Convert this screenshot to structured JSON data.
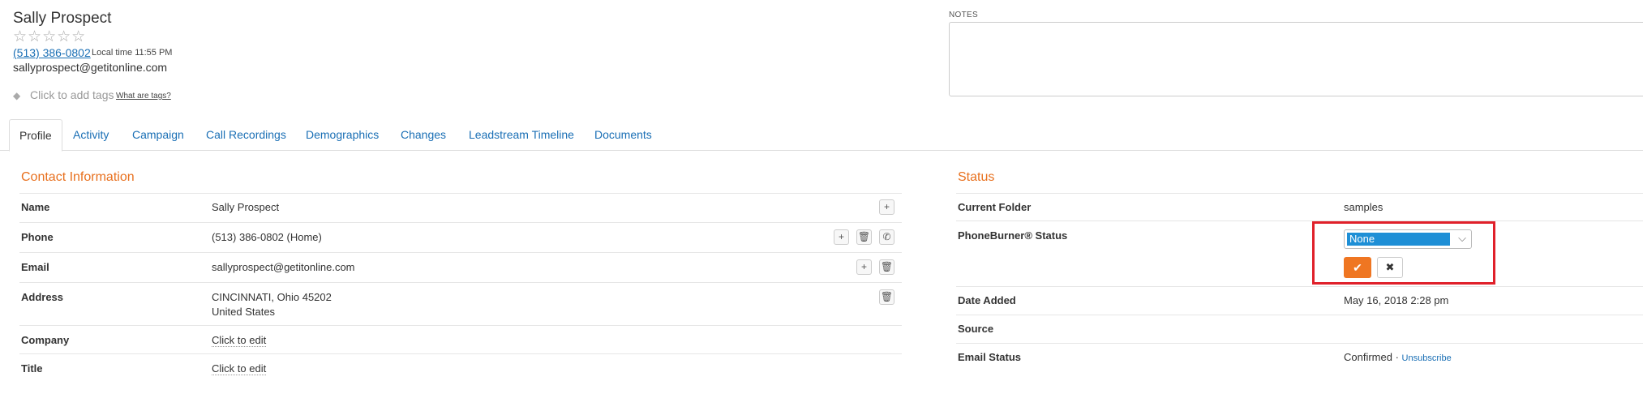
{
  "contact": {
    "name": "Sally Prospect",
    "stars": "☆☆☆☆☆",
    "phone": "(513) 386-0802",
    "local_time": "Local time 11:55 PM",
    "email": "sallyprospect@getitonline.com",
    "tags_placeholder": "Click to add tags",
    "tags_help": "What are tags?"
  },
  "notes": {
    "label": "NOTES"
  },
  "tabs": [
    {
      "label": "Profile"
    },
    {
      "label": "Activity"
    },
    {
      "label": "Campaign"
    },
    {
      "label": "Call Recordings"
    },
    {
      "label": "Demographics"
    },
    {
      "label": "Changes"
    },
    {
      "label": "Leadstream Timeline"
    },
    {
      "label": "Documents"
    }
  ],
  "contact_info": {
    "title": "Contact Information",
    "rows": [
      {
        "label": "Name",
        "value": "Sally Prospect"
      },
      {
        "label": "Phone",
        "value": "(513) 386-0802 (Home)"
      },
      {
        "label": "Email",
        "value": "sallyprospect@getitonline.com"
      },
      {
        "label": "Address",
        "value": "CINCINNATI, Ohio 45202",
        "value2": "United States"
      },
      {
        "label": "Company",
        "value": "Click to edit"
      },
      {
        "label": "Title",
        "value": "Click to edit"
      }
    ]
  },
  "status": {
    "title": "Status",
    "current_folder_label": "Current Folder",
    "current_folder_value": "samples",
    "pb_status_label": "PhoneBurner® Status",
    "pb_status_selected": "None",
    "date_added_label": "Date Added",
    "date_added_value": "May 16, 2018 2:28 pm",
    "source_label": "Source",
    "email_status_label": "Email Status",
    "email_status_value": "Confirmed ·",
    "unsubscribe": "Unsubscribe"
  },
  "colors": {
    "accent": "#e8701e",
    "link": "#1a6fb5",
    "highlight": "#e0202a",
    "selected": "#1e8fd6"
  },
  "icons": {
    "plus": "+",
    "trash": "🗑",
    "phone": "✆",
    "check": "✔",
    "close": "✖",
    "tag": "◆",
    "caret": "⌵"
  }
}
